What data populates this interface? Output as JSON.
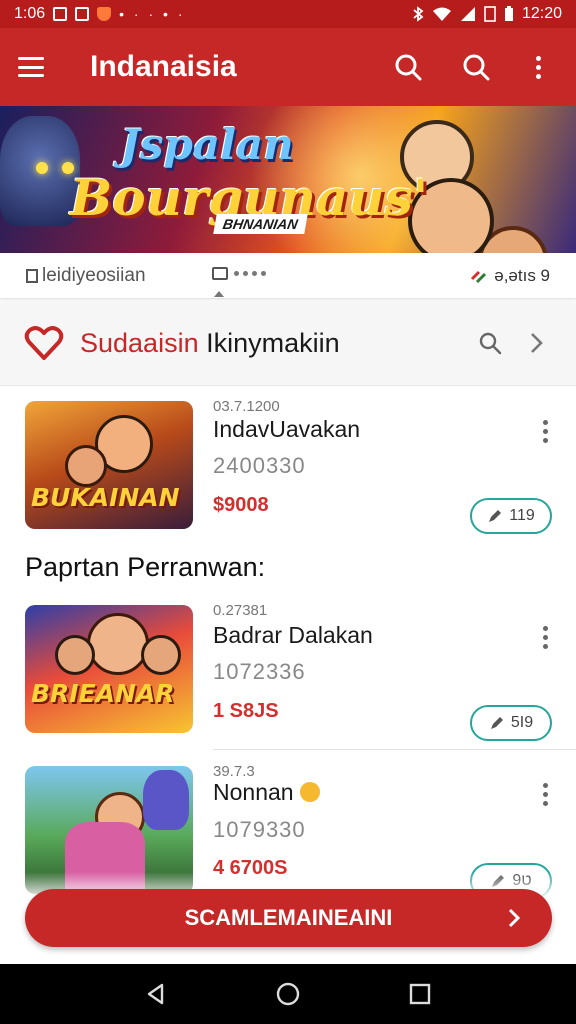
{
  "status_bar": {
    "time_left": "1:06",
    "time_right": "12:20",
    "dots": "• · ·  • ·"
  },
  "app_bar": {
    "title": "Indanaisia"
  },
  "banner": {
    "title_line1": "Jspalan",
    "title_line2": "Bourgunaus'",
    "subtitle": "BHNANIAN"
  },
  "tabs": {
    "left_label": "leidiyeosiian",
    "right_label": "ə,ətıs 9"
  },
  "section": {
    "title_red": "Sudaaisin",
    "title_dark": "Ikinymakiin"
  },
  "cards": [
    {
      "thumb_text": "BUKAINAN",
      "meta": "03.7.1200",
      "title": "IndavUavakan",
      "count": "2400330",
      "price": "$9008",
      "pill_label": "119"
    },
    {
      "thumb_text": "BRIEANAR",
      "meta": "0.27381",
      "title": "Badrar Dalakan",
      "count": "1072336",
      "price": "1 S8JS",
      "pill_label": "5I9"
    },
    {
      "thumb_text": "",
      "meta": "39.7.3",
      "title": "Nonnan",
      "count": "1079330",
      "price": "4 6700S",
      "pill_label": "ט9"
    }
  ],
  "subheading": "Paprtan Perranwan:",
  "cta": {
    "label": "SCAMLEMAINEAINI"
  },
  "colors": {
    "primary": "#c62828",
    "status": "#b71c1c",
    "accent_teal": "#26a69a",
    "price_red": "#d32f2f"
  }
}
